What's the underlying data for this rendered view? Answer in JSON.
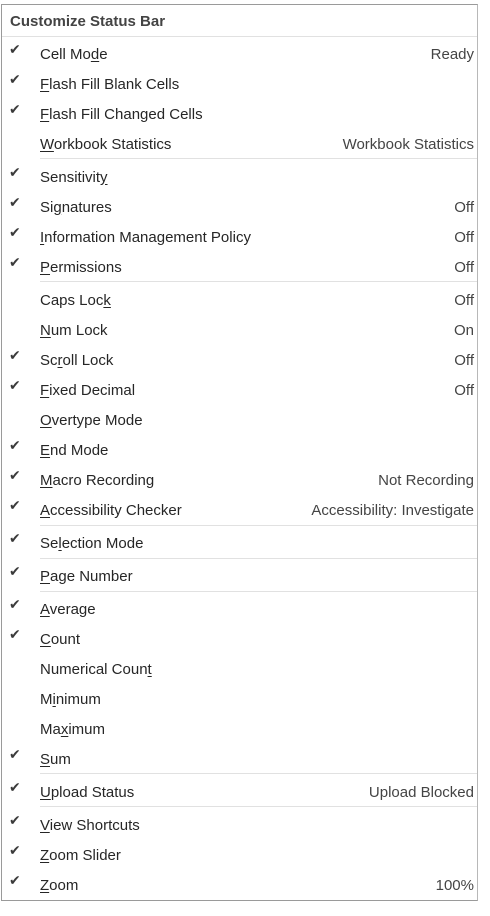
{
  "menu": {
    "title": "Customize Status Bar",
    "check_glyph": "✔",
    "items": [
      {
        "checked": true,
        "pre": "Cell Mo",
        "acc": "d",
        "post": "e",
        "value": "Ready"
      },
      {
        "checked": true,
        "pre": "",
        "acc": "F",
        "post": "lash Fill Blank Cells",
        "value": ""
      },
      {
        "checked": true,
        "pre": "",
        "acc": "F",
        "post": "lash Fill Changed Cells",
        "value": ""
      },
      {
        "checked": false,
        "pre": "",
        "acc": "W",
        "post": "orkbook Statistics",
        "value": "Workbook Statistics"
      },
      {
        "checked": true,
        "pre": "Sensitivit",
        "acc": "y",
        "post": "",
        "value": ""
      },
      {
        "checked": true,
        "pre": "Si",
        "acc": "g",
        "post": "natures",
        "value": "Off"
      },
      {
        "checked": true,
        "pre": "",
        "acc": "I",
        "post": "nformation Management Policy",
        "value": "Off"
      },
      {
        "checked": true,
        "pre": "",
        "acc": "P",
        "post": "ermissions",
        "value": "Off"
      },
      {
        "checked": false,
        "pre": "Caps Loc",
        "acc": "k",
        "post": "",
        "value": "Off"
      },
      {
        "checked": false,
        "pre": "",
        "acc": "N",
        "post": "um Lock",
        "value": "On"
      },
      {
        "checked": true,
        "pre": "Sc",
        "acc": "r",
        "post": "oll Lock",
        "value": "Off"
      },
      {
        "checked": true,
        "pre": "",
        "acc": "F",
        "post": "ixed Decimal",
        "value": "Off"
      },
      {
        "checked": false,
        "pre": "",
        "acc": "O",
        "post": "vertype Mode",
        "value": ""
      },
      {
        "checked": true,
        "pre": "",
        "acc": "E",
        "post": "nd Mode",
        "value": ""
      },
      {
        "checked": true,
        "pre": "",
        "acc": "M",
        "post": "acro Recording",
        "value": "Not Recording"
      },
      {
        "checked": true,
        "pre": "",
        "acc": "A",
        "post": "ccessibility Checker",
        "value": "Accessibility: Investigate"
      },
      {
        "checked": true,
        "pre": "Se",
        "acc": "l",
        "post": "ection Mode",
        "value": ""
      },
      {
        "checked": true,
        "pre": "",
        "acc": "P",
        "post": "age Number",
        "value": ""
      },
      {
        "checked": true,
        "pre": "",
        "acc": "A",
        "post": "verage",
        "value": ""
      },
      {
        "checked": true,
        "pre": "",
        "acc": "C",
        "post": "ount",
        "value": ""
      },
      {
        "checked": false,
        "pre": "Numerical Coun",
        "acc": "t",
        "post": "",
        "value": ""
      },
      {
        "checked": false,
        "pre": "M",
        "acc": "i",
        "post": "nimum",
        "value": ""
      },
      {
        "checked": false,
        "pre": "Ma",
        "acc": "x",
        "post": "imum",
        "value": ""
      },
      {
        "checked": true,
        "pre": "",
        "acc": "S",
        "post": "um",
        "value": ""
      },
      {
        "checked": true,
        "pre": "",
        "acc": "U",
        "post": "pload Status",
        "value": "Upload Blocked"
      },
      {
        "checked": true,
        "pre": "",
        "acc": "V",
        "post": "iew Shortcuts",
        "value": ""
      },
      {
        "checked": true,
        "pre": "",
        "acc": "Z",
        "post": "oom Slider",
        "value": ""
      },
      {
        "checked": true,
        "pre": "",
        "acc": "Z",
        "post": "oom",
        "value": "100%"
      }
    ]
  }
}
